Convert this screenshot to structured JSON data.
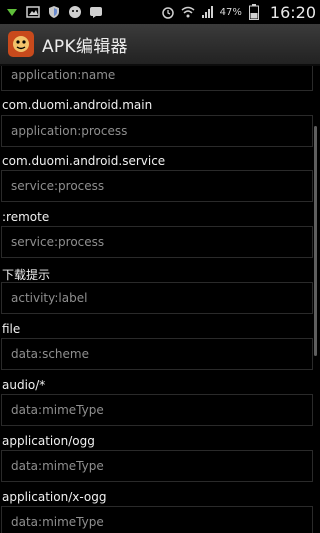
{
  "status_bar": {
    "battery_text": "47%",
    "time": "16:20",
    "left_icons": [
      "download-icon",
      "gallery-icon",
      "shield-icon",
      "bug-icon",
      "chat-icon"
    ],
    "right_icons": [
      "alarm-icon",
      "wifi-icon",
      "signal-icon",
      "battery-icon"
    ]
  },
  "action_bar": {
    "title": "APK编辑器",
    "accent_color": "#c84a1c"
  },
  "rows": [
    {
      "field": "application:name",
      "value": "com.duomi.android.main"
    },
    {
      "field": "application:process",
      "value": "com.duomi.android.service"
    },
    {
      "field": "service:process",
      "value": ":remote"
    },
    {
      "field": "service:process",
      "value": "下载提示"
    },
    {
      "field": "activity:label",
      "value": "file"
    },
    {
      "field": "data:scheme",
      "value": "audio/*"
    },
    {
      "field": "data:mimeType",
      "value": "application/ogg"
    },
    {
      "field": "data:mimeType",
      "value": "application/x-ogg"
    },
    {
      "field": "data:mimeType",
      "value": ""
    }
  ]
}
